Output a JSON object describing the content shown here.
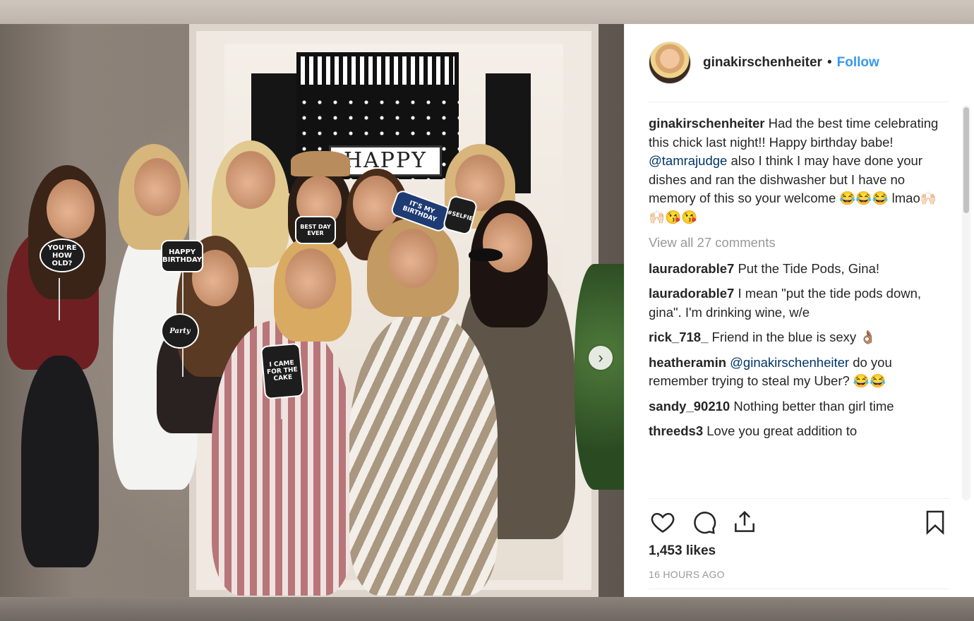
{
  "header": {
    "username": "ginakirschenheiter",
    "separator": "•",
    "follow_label": "Follow"
  },
  "caption": {
    "username": "ginakirschenheiter",
    "text_before_mention": " Had the best time celebrating this chick last night!! Happy birthday babe! ",
    "mention": "@tamrajudge",
    "text_after_mention": " also I think I may have done your dishes and ran the dishwasher but I have no memory of this so your welcome 😂😂😂 lmao🙌🏻🙌🏻😘😘"
  },
  "view_all_comments": "View all 27 comments",
  "comments": [
    {
      "username": "lauradorable7",
      "text": " Put the Tide Pods, Gina!"
    },
    {
      "username": "lauradorable7",
      "text": " I mean \"put the tide pods down, gina\". I'm drinking wine, w/e"
    },
    {
      "username": "rick_718_",
      "text": " Friend in the blue is sexy 👌🏽"
    },
    {
      "username": "heatheramin",
      "mention": "@ginakirschenheiter",
      "text": " do you remember trying to steal my Uber? 😂😂"
    },
    {
      "username": "sandy_90210",
      "text": " Nothing better than girl time"
    },
    {
      "username": "threeds3",
      "text": " Love you great addition to"
    }
  ],
  "likes": "1,453 likes",
  "timestamp": "16 HOURS AGO",
  "photo": {
    "sign_text": "HAPPY",
    "props": [
      "YOU'RE HOW OLD?",
      "HAPPY BIRTHDAY",
      "BEST DAY EVER",
      "IT'S MY BIRTHDAY",
      "#SELFIE",
      "Party",
      "I CAME FOR THE CAKE"
    ]
  },
  "icons": {
    "like": "heart-icon",
    "comment": "comment-icon",
    "share": "share-icon",
    "save": "bookmark-icon",
    "next": "chevron-right-icon"
  }
}
